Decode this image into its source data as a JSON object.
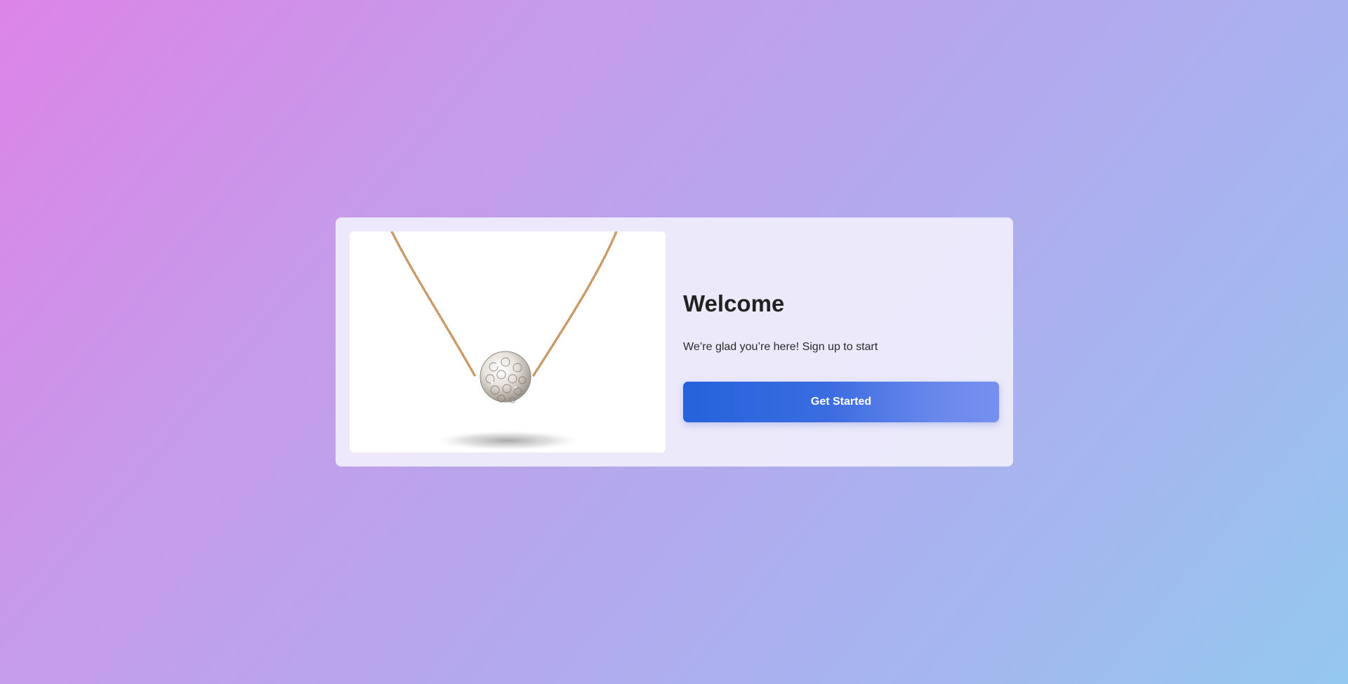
{
  "welcome": {
    "title": "Welcome",
    "subtitle": "We’re glad you’re here! Sign up to start",
    "cta_label": "Get Started"
  },
  "image": {
    "subject": "necklace-icon"
  },
  "colors": {
    "background_start": "#dc84e8",
    "background_end": "#94c8f0",
    "button_start": "#2563dc",
    "button_end": "#7690ef",
    "card": "#efedfb"
  }
}
